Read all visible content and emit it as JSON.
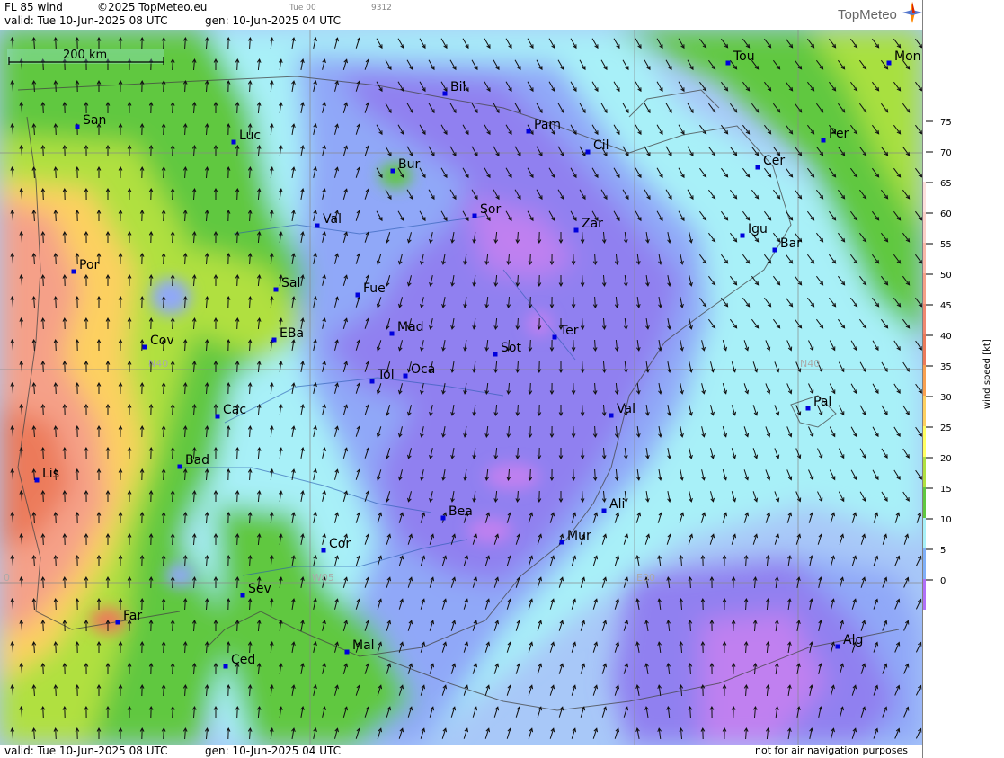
{
  "header": {
    "product": "FL 85 wind",
    "copyright": "©2025 TopMeteo.eu",
    "run_tag": "Tue 00",
    "code": "9312",
    "valid": "valid:  Tue  10-Jun-2025  08 UTC",
    "gen": "gen: 10-Jun-2025 04 UTC",
    "brand": "TopMeteo"
  },
  "footer": {
    "valid": "valid:  Tue  10-Jun-2025  08 UTC",
    "gen": "gen: 10-Jun-2025 04 UTC",
    "disclaimer": "not for air navigation purposes"
  },
  "scale_bar": {
    "label": "200 km"
  },
  "grid_labels": {
    "lat_left": "N40",
    "lat_right": "N40",
    "lon_w": "W05",
    "lon_e": "E00",
    "lon_far_w": "0"
  },
  "legend": {
    "title": "wind speed  [kt]",
    "ticks": [
      "75",
      "70",
      "65",
      "60",
      "55",
      "50",
      "45",
      "40",
      "35",
      "30",
      "25",
      "20",
      "15",
      "10",
      "5",
      "0"
    ],
    "colors": [
      "#ffffff",
      "#ffffff",
      "#fde0dd",
      "#fbd0c8",
      "#f9b8a8",
      "#f5a088",
      "#f08870",
      "#ec7a5a",
      "#f8a050",
      "#fdd060",
      "#ffff60",
      "#b0e040",
      "#60c840",
      "#a8f0f8",
      "#80b0f8",
      "#b070f8"
    ]
  },
  "cities": [
    {
      "name": "Bil"
    },
    {
      "name": "Pam"
    },
    {
      "name": "Cil"
    },
    {
      "name": "Tou"
    },
    {
      "name": "Mon"
    },
    {
      "name": "San"
    },
    {
      "name": "Luc"
    },
    {
      "name": "Bur"
    },
    {
      "name": "Per"
    },
    {
      "name": "Cer"
    },
    {
      "name": "Sor"
    },
    {
      "name": "Zar"
    },
    {
      "name": "Igu"
    },
    {
      "name": "Bar"
    },
    {
      "name": "Val"
    },
    {
      "name": "Por"
    },
    {
      "name": "Sal"
    },
    {
      "name": "Fue"
    },
    {
      "name": "Mad"
    },
    {
      "name": "Ter"
    },
    {
      "name": "Cov"
    },
    {
      "name": "EBa"
    },
    {
      "name": "Sot"
    },
    {
      "name": "Tol"
    },
    {
      "name": "Oca"
    },
    {
      "name": "Pal"
    },
    {
      "name": "Cac"
    },
    {
      "name": "Val"
    },
    {
      "name": "Lis"
    },
    {
      "name": "Bad"
    },
    {
      "name": "Bea"
    },
    {
      "name": "Ali"
    },
    {
      "name": "Mur"
    },
    {
      "name": "Cor"
    },
    {
      "name": "Sev"
    },
    {
      "name": "Far"
    },
    {
      "name": "Mal"
    },
    {
      "name": "Ced"
    },
    {
      "name": "Alg"
    }
  ]
}
